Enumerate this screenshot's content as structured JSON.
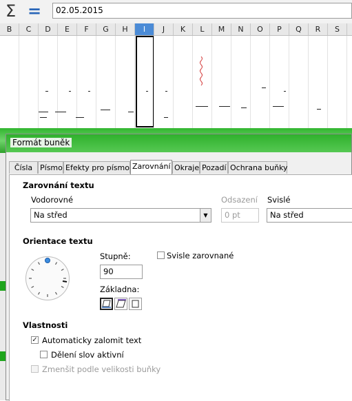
{
  "formula_bar": {
    "sum_icon": "sigma-icon",
    "function_icon": "equals-icon",
    "value": "02.05.2015"
  },
  "columns": [
    "B",
    "C",
    "D",
    "E",
    "F",
    "G",
    "H",
    "I",
    "J",
    "K",
    "L",
    "M",
    "N",
    "O",
    "P",
    "Q",
    "R",
    "S"
  ],
  "selected_column": "I",
  "dialog": {
    "title": "Formát buněk",
    "tabs": [
      "Čísla",
      "Písmo",
      "Efekty pro písmo",
      "Zarovnání",
      "Okraje",
      "Pozadí",
      "Ochrana buňky"
    ],
    "active_tab": "Zarovnání",
    "text_alignment": {
      "heading": "Zarovnání textu",
      "horizontal_label": "Vodorovné",
      "horizontal_value": "Na střed",
      "indent_label": "Odsazení",
      "indent_value": "0 pt",
      "vertical_label": "Svislé",
      "vertical_value": "Na střed"
    },
    "orientation": {
      "heading": "Orientace textu",
      "degrees_label": "Stupně:",
      "degrees_value": "90",
      "stacked_label": "Svisle zarovnané",
      "stacked_checked": false,
      "reference_label": "Základna:",
      "reference_edge_icons": [
        "bottom-edge-icon",
        "top-edge-icon",
        "cell-inside-icon"
      ],
      "active_reference": 0
    },
    "properties": {
      "heading": "Vlastnosti",
      "wrap_label": "Automaticky zalomit text",
      "wrap_checked": true,
      "hyphenation_label": "Dělení slov aktivní",
      "hyphenation_checked": false,
      "shrink_label": "Zmenšit podle velikosti buňky",
      "shrink_checked": false
    }
  }
}
